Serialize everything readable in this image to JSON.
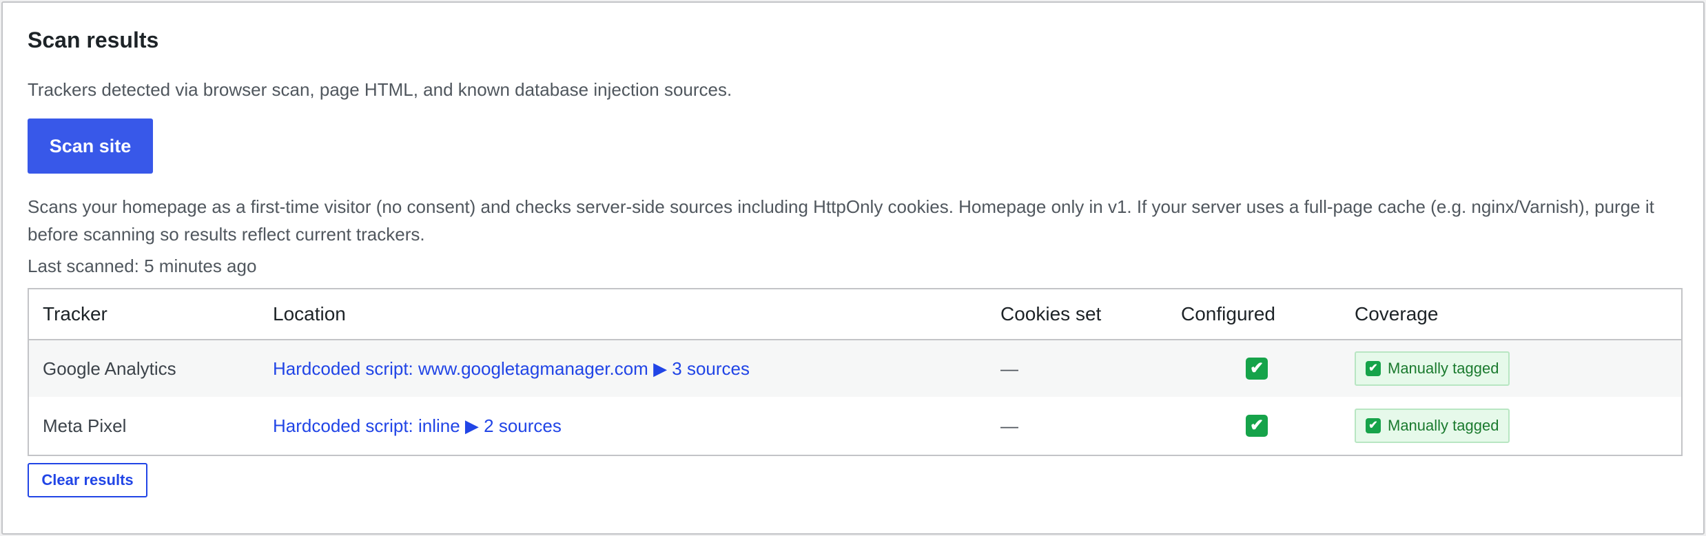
{
  "panel": {
    "title": "Scan results",
    "description": "Trackers detected via browser scan, page HTML, and known database injection sources.",
    "scan_button": "Scan site",
    "note": "Scans your homepage as a first-time visitor (no consent) and checks server-side sources including HttpOnly cookies. Homepage only in v1. If your server uses a full-page cache (e.g. nginx/Varnish), purge it before scanning so results reflect current trackers.",
    "last_scanned": "Last scanned: 5 minutes ago",
    "clear_button": "Clear results"
  },
  "table": {
    "headers": {
      "tracker": "Tracker",
      "location": "Location",
      "cookies": "Cookies set",
      "configured": "Configured",
      "coverage": "Coverage"
    },
    "rows": [
      {
        "tracker": "Google Analytics",
        "location": "Hardcoded script: www.googletagmanager.com ▶ 3 sources",
        "cookies": "—",
        "configured": "✔",
        "coverage": "Manually tagged"
      },
      {
        "tracker": "Meta Pixel",
        "location": "Hardcoded script: inline ▶ 2 sources",
        "cookies": "—",
        "configured": "✔",
        "coverage": "Manually tagged"
      }
    ]
  },
  "colors": {
    "primary_button": "#3858e9",
    "link": "#2145e6",
    "check_green": "#16a34a",
    "badge_bg": "#e6f9ea",
    "badge_text": "#1a7a2e"
  },
  "icons": {
    "configured": "check-box-icon",
    "coverage": "check-box-icon"
  }
}
